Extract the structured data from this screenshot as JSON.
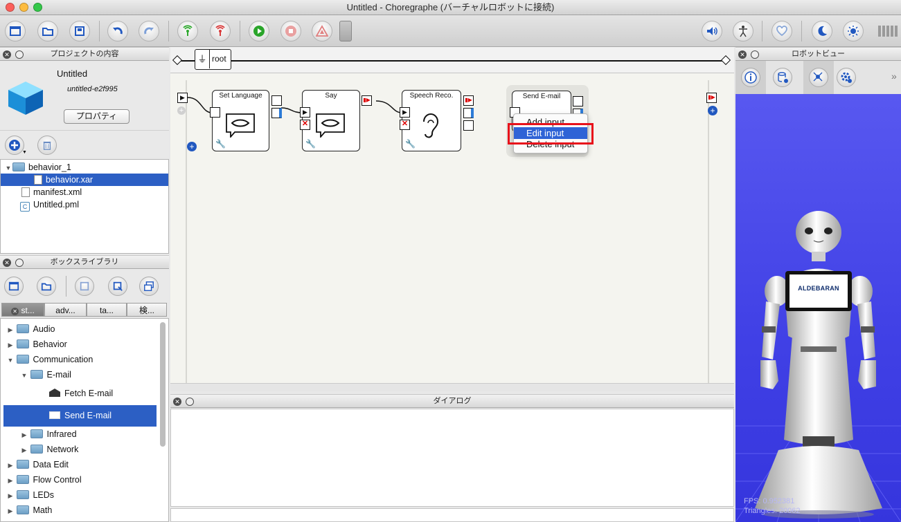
{
  "window": {
    "title": "Untitled - Choregraphe (バーチャルロボットに接続)"
  },
  "toolbar": {
    "left_icons": [
      "new-project-icon",
      "open-project-icon",
      "save-project-icon",
      "undo-icon",
      "redo-icon",
      "connect-icon",
      "disconnect-icon",
      "play-icon",
      "stop-icon",
      "debug-warning-icon",
      "toggle-indicator-icon"
    ],
    "right_icons": [
      "volume-icon",
      "stiffness-body-icon",
      "heart-icon",
      "rest-moon-icon",
      "wake-up-sun-icon",
      "battery-icon"
    ]
  },
  "project_panel": {
    "header": "プロジェクトの内容",
    "project_name": "Untitled",
    "project_id": "untitled-e2f995",
    "properties_button": "プロパティ",
    "files": [
      {
        "label": "behavior_1",
        "type": "folder"
      },
      {
        "label": "behavior.xar",
        "type": "file",
        "selected": true
      },
      {
        "label": "manifest.xml",
        "type": "file"
      },
      {
        "label": "Untitled.pml",
        "type": "pml"
      }
    ]
  },
  "library_panel": {
    "header": "ボックスライブラリ",
    "tabs": [
      "st...",
      "adv...",
      "ta...",
      "検..."
    ],
    "tree": [
      {
        "label": "Audio",
        "level": 0,
        "expanded": false
      },
      {
        "label": "Behavior",
        "level": 0,
        "expanded": false
      },
      {
        "label": "Communication",
        "level": 0,
        "expanded": true
      },
      {
        "label": "E-mail",
        "level": 1,
        "expanded": true
      },
      {
        "label": "Fetch E-mail",
        "level": 2
      },
      {
        "label": "Send E-mail",
        "level": 2,
        "selected": true
      },
      {
        "label": "Infrared",
        "level": 1,
        "expanded": false
      },
      {
        "label": "Network",
        "level": 1,
        "expanded": false
      },
      {
        "label": "Data Edit",
        "level": 0,
        "expanded": false
      },
      {
        "label": "Flow Control",
        "level": 0,
        "expanded": false
      },
      {
        "label": "LEDs",
        "level": 0,
        "expanded": false
      },
      {
        "label": "Math",
        "level": 0,
        "expanded": false
      }
    ]
  },
  "graph": {
    "breadcrumb": "root",
    "boxes": [
      {
        "title": "Set Language",
        "icon": "lips-icon"
      },
      {
        "title": "Say",
        "icon": "lips-icon"
      },
      {
        "title": "Speech Reco.",
        "icon": "ear-icon"
      },
      {
        "title": "Send E-mail",
        "icon": "mail-icon"
      }
    ],
    "context_menu": {
      "items": [
        "Add input",
        "Edit input",
        "Delete input"
      ],
      "highlighted": "Edit input",
      "highlight_color": "#e8101a"
    }
  },
  "dialog_panel": {
    "header": "ダイアログ"
  },
  "robot_panel": {
    "header": "ロボットビュー",
    "tools": [
      "info-icon",
      "memory-cylinder-icon",
      "joint-icon",
      "settings-gear-icon"
    ],
    "logo_text": "ALDEBARAN",
    "fps": "FPS: 0.952381",
    "triangles": "Triangles: 20062"
  },
  "colors": {
    "selection": "#2c5fc4",
    "robot_background": "#4141e6",
    "canvas": "#f4f4ef"
  }
}
